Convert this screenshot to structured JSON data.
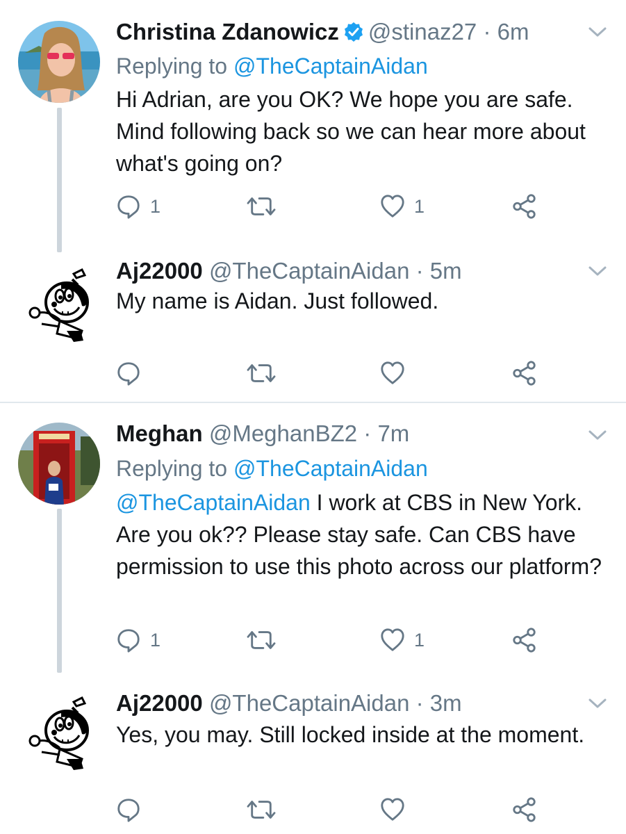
{
  "tweets": [
    {
      "name": "Christina Zdanowicz",
      "verified": true,
      "handle": "@stinaz27",
      "time": "· 6m",
      "replying_prefix": "Replying to",
      "replying_to": "@TheCaptainAidan",
      "text": "Hi Adrian, are you OK? We hope you are safe. Mind following back so we can hear more about what's going on?",
      "reply_count": "1",
      "like_count": "1"
    },
    {
      "name": "Aj22000",
      "handle": "@TheCaptainAidan",
      "time": "· 5m",
      "text": "My name is Aidan. Just followed."
    },
    {
      "name": "Meghan",
      "handle": "@MeghanBZ2",
      "time": "· 7m",
      "replying_prefix": "Replying to",
      "replying_to": "@TheCaptainAidan",
      "mention": "@TheCaptainAidan",
      "text": " I work at CBS in New York. Are you ok?? Please stay safe. Can CBS have permission to use this photo across our platform?",
      "reply_count": "1",
      "like_count": "1"
    },
    {
      "name": "Aj22000",
      "handle": "@TheCaptainAidan",
      "time": "· 3m",
      "text": "Yes, you may. Still locked inside at the moment."
    }
  ],
  "colors": {
    "link": "#1b95e0",
    "secondary": "#657786",
    "thread_line": "#cdd5dc",
    "divider": "#e1e8ed"
  }
}
